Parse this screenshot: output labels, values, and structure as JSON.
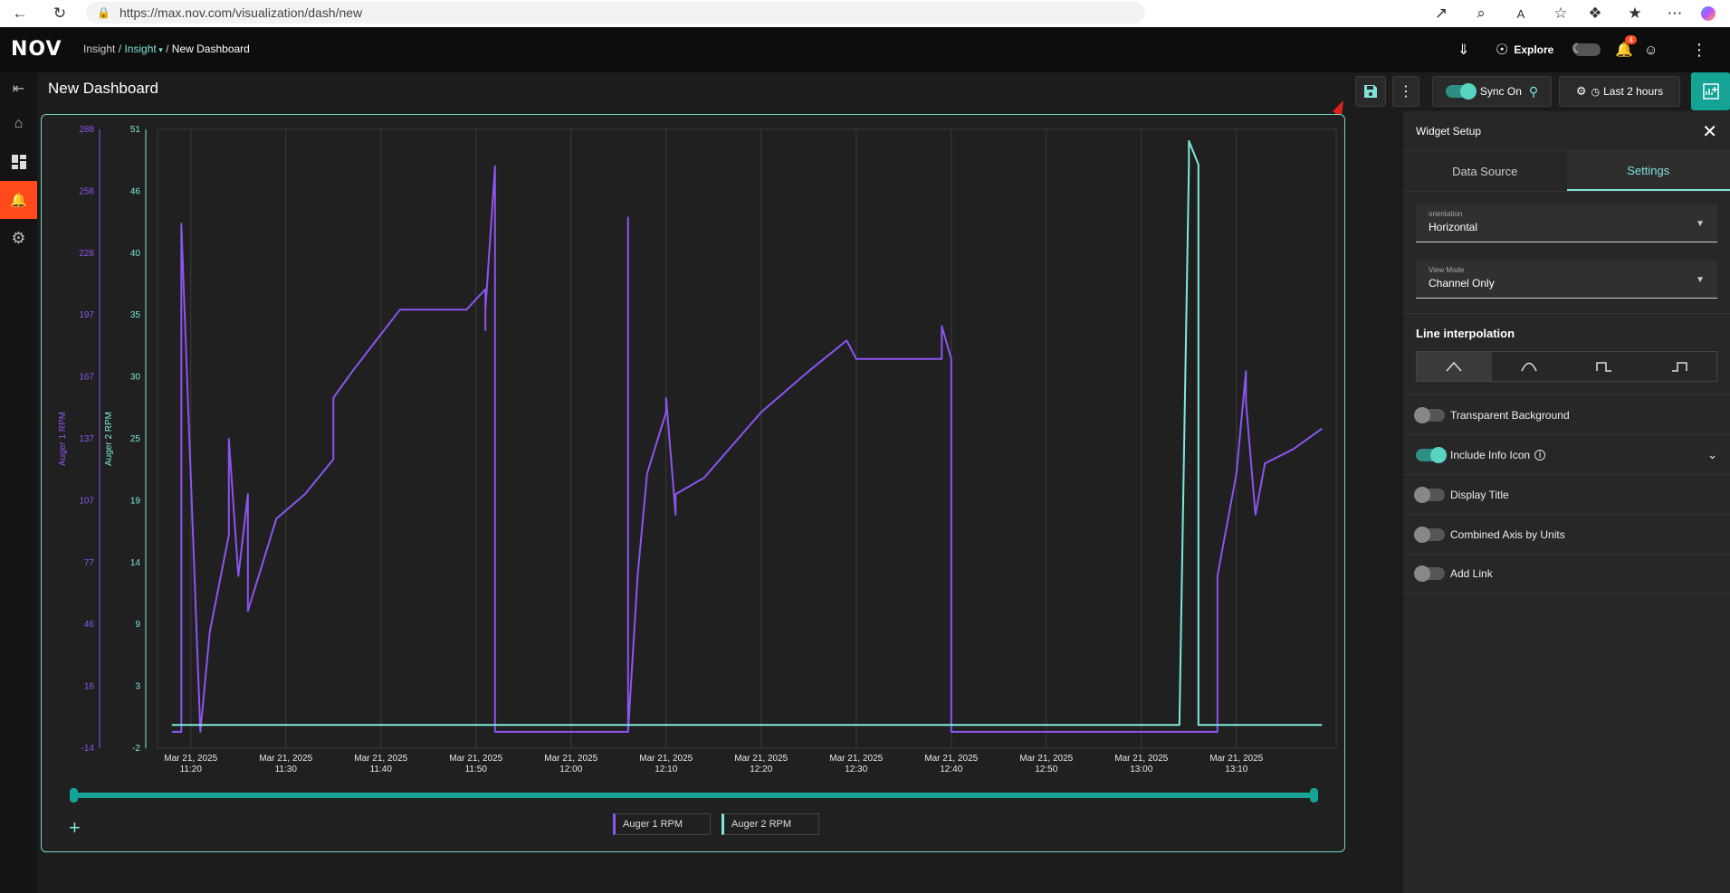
{
  "browser": {
    "url": "https://max.nov.com/visualization/dash/new"
  },
  "header": {
    "logo": "NOV",
    "crumb_root": "Insight /",
    "crumb_app": "Insight",
    "crumb_sep": "/",
    "crumb_current": "New Dashboard",
    "explore_label": "Explore",
    "notification_count": "4"
  },
  "toolbar": {
    "page_title": "New Dashboard",
    "sync_label": "Sync On",
    "time_range_label": "Last 2 hours"
  },
  "chart_data": {
    "type": "line",
    "y_axes": [
      {
        "name": "Auger 1 RPM",
        "ticks": [
          "288",
          "258",
          "228",
          "197",
          "167",
          "137",
          "107",
          "77",
          "46",
          "16",
          "-14"
        ],
        "ylim": [
          -14,
          288
        ]
      },
      {
        "name": "Auger 2 RPM",
        "ticks": [
          "51",
          "46",
          "40",
          "35",
          "30",
          "25",
          "19",
          "14",
          "9",
          "3",
          "-2"
        ],
        "ylim": [
          -2,
          51
        ]
      }
    ],
    "x_ticks": [
      {
        "date": "Mar 21, 2025",
        "time": "11:20"
      },
      {
        "date": "Mar 21, 2025",
        "time": "11:30"
      },
      {
        "date": "Mar 21, 2025",
        "time": "11:40"
      },
      {
        "date": "Mar 21, 2025",
        "time": "11:50"
      },
      {
        "date": "Mar 21, 2025",
        "time": "12:00"
      },
      {
        "date": "Mar 21, 2025",
        "time": "12:10"
      },
      {
        "date": "Mar 21, 2025",
        "time": "12:20"
      },
      {
        "date": "Mar 21, 2025",
        "time": "12:30"
      },
      {
        "date": "Mar 21, 2025",
        "time": "12:40"
      },
      {
        "date": "Mar 21, 2025",
        "time": "12:50"
      },
      {
        "date": "Mar 21, 2025",
        "time": "13:00"
      },
      {
        "date": "Mar 21, 2025",
        "time": "13:10"
      }
    ],
    "series": [
      {
        "name": "Auger 1 RPM",
        "color": "#8b55f0",
        "x": [
          "11:18",
          "11:19",
          "11:19",
          "11:21",
          "11:21",
          "11:22",
          "11:24",
          "11:24",
          "11:25",
          "11:26",
          "11:26",
          "11:29",
          "11:32",
          "11:35",
          "11:35",
          "11:37",
          "11:42",
          "11:47",
          "11:49",
          "11:51",
          "11:51",
          "11:51",
          "11:52",
          "11:52",
          "11:52",
          "12:06",
          "12:06",
          "12:06",
          "12:07",
          "12:08",
          "12:10",
          "12:10",
          "12:11",
          "12:11",
          "12:14",
          "12:20",
          "12:25",
          "12:29",
          "12:30",
          "12:35",
          "12:39",
          "12:39",
          "12:40",
          "12:40",
          "12:40",
          "13:08",
          "13:08",
          "13:10",
          "13:11",
          "13:11",
          "13:12",
          "13:13",
          "13:16",
          "13:19"
        ],
        "y": [
          -6,
          -6,
          242,
          -6,
          -6,
          43,
          90,
          137,
          70,
          110,
          53,
          98,
          110,
          127,
          157,
          170,
          200,
          200,
          200,
          210,
          190,
          200,
          270,
          270,
          -6,
          -6,
          245,
          -6,
          70,
          120,
          150,
          157,
          100,
          110,
          118,
          150,
          170,
          185,
          176,
          176,
          176,
          192,
          176,
          -6,
          -6,
          -6,
          70,
          120,
          170,
          155,
          100,
          125,
          132,
          142
        ]
      },
      {
        "name": "Auger 2 RPM",
        "color": "#7fe9dd",
        "x": [
          "11:18",
          "13:04",
          "13:05",
          "13:05",
          "13:06",
          "13:06",
          "13:19"
        ],
        "y": [
          0,
          0,
          48,
          50,
          48,
          0,
          0
        ]
      }
    ]
  },
  "legend": {
    "series_1": "Auger 1 RPM",
    "series_2": "Auger 2 RPM"
  },
  "panel": {
    "title": "Widget Setup",
    "tab_data_source": "Data Source",
    "tab_settings": "Settings",
    "orientation_label": "orientation",
    "orientation_value": "Horizontal",
    "view_mode_label": "View Mode",
    "view_mode_value": "Channel Only",
    "interpolation_title": "Line interpolation",
    "toggles": {
      "transparent_bg": "Transparent Background",
      "include_info_icon": "Include Info Icon",
      "display_title": "Display Title",
      "combined_axis": "Combined Axis by Units",
      "add_link": "Add Link"
    }
  },
  "colors": {
    "accent": "#7fe3d8",
    "alert": "#ff4a1c",
    "series1": "#8b55f0",
    "series2": "#7fe9dd"
  }
}
